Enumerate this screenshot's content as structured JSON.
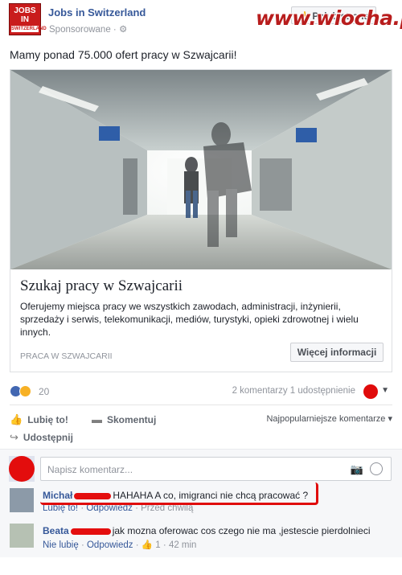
{
  "header": {
    "logo_lines": [
      "JOBS",
      "IN",
      "SWITZERLAND"
    ],
    "page_name": "Jobs in Switzerland",
    "sponsored": "Sponsorowane · ",
    "like_page": "Polub stronę",
    "watermark": "www.wiocha.pl"
  },
  "post": {
    "text": "Mamy ponad 75.000 ofert pracy w Szwajcarii!"
  },
  "ad": {
    "title": "Szukaj pracy w Szwajcarii",
    "description": "Oferujemy miejsca pracy we wszystkich zawodach, administracji, inżynierii, sprzedaży i serwis, telekomunikacji, mediów, turystyki, opieki zdrowotnej i wielu innych.",
    "domain": "PRACA W SZWAJCARII",
    "cta": "Więcej informacji"
  },
  "stats": {
    "reactions_count": "20",
    "comments_shares": "2 komentarzy  1 udostępnienie"
  },
  "actions": {
    "like": "Lubię to!",
    "comment": "Skomentuj",
    "share": "Udostępnij",
    "sort": "Najpopularniejsze komentarze ▾"
  },
  "composer": {
    "placeholder": "Napisz komentarz..."
  },
  "comments": [
    {
      "author": "Michał",
      "text": "HAHAHA A co, imigranci nie chcą pracować ?",
      "meta_like": "Lubię to!",
      "meta_reply": "Odpowiedz",
      "meta_time": "Przed chwilą"
    },
    {
      "author": "Beata",
      "text": "jak mozna oferowac cos czego nie ma ,jestescie pierdolnieci",
      "meta_like": "Nie lubię",
      "meta_reply": "Odpowiedz",
      "meta_likes_count": "1",
      "meta_time": "42 min"
    }
  ],
  "colors": {
    "link": "#365899",
    "scribble_red": "#e00b0b",
    "brand_red": "#c91c1c"
  }
}
